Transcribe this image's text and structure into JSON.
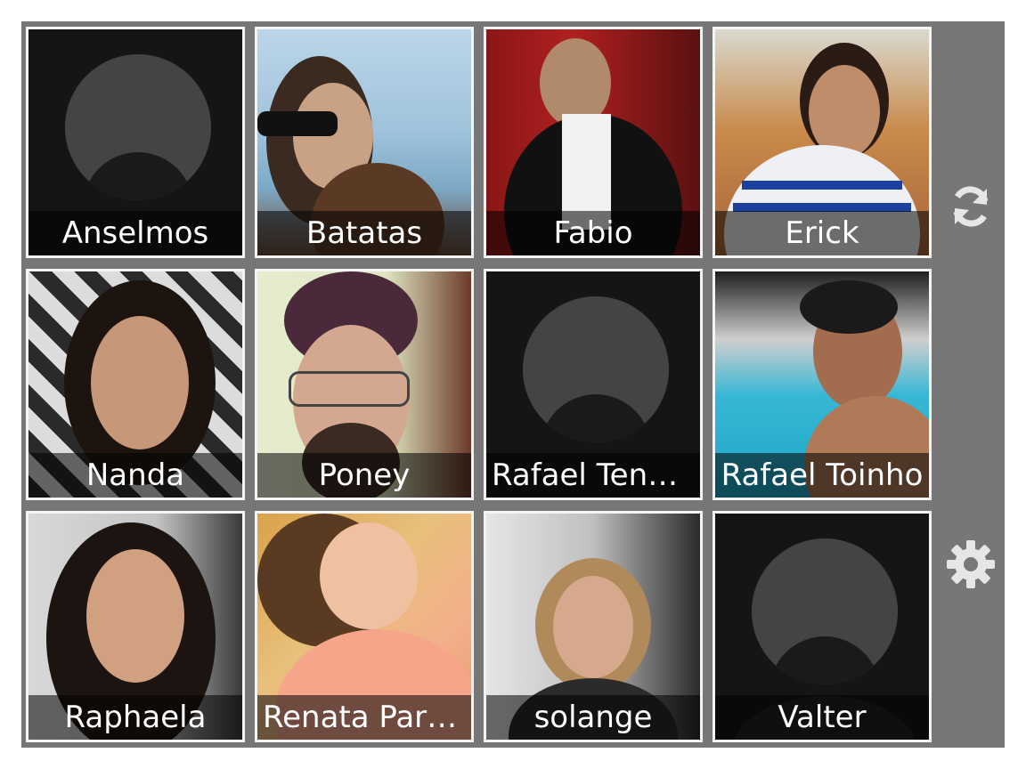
{
  "contacts": [
    {
      "name": "Anselmos",
      "photo": "default-avatar"
    },
    {
      "name": "Batatas",
      "photo": "man-sunglasses"
    },
    {
      "name": "Fabio",
      "photo": "man-dark-jacket"
    },
    {
      "name": "Erick",
      "photo": "man-striped-shirt"
    },
    {
      "name": "Nanda",
      "photo": "woman-dark-hair"
    },
    {
      "name": "Poney",
      "photo": "man-glasses"
    },
    {
      "name": "Rafael Tenor…",
      "photo": "default-avatar"
    },
    {
      "name": "Rafael Toinho",
      "photo": "man-pool"
    },
    {
      "name": "Raphaela",
      "photo": "woman-smiling"
    },
    {
      "name": "Renata Para…",
      "photo": "woman-pink-top"
    },
    {
      "name": "solange",
      "photo": "woman-blonde"
    },
    {
      "name": "Valter",
      "photo": "default-avatar"
    }
  ],
  "icons": {
    "sync": "sync-icon",
    "settings": "gear-icon"
  },
  "colors": {
    "panel": "#777777",
    "tile_border": "#f4f4f4",
    "label_overlay": "rgba(0,0,0,0.55)",
    "icon": "#e6e6e6"
  }
}
